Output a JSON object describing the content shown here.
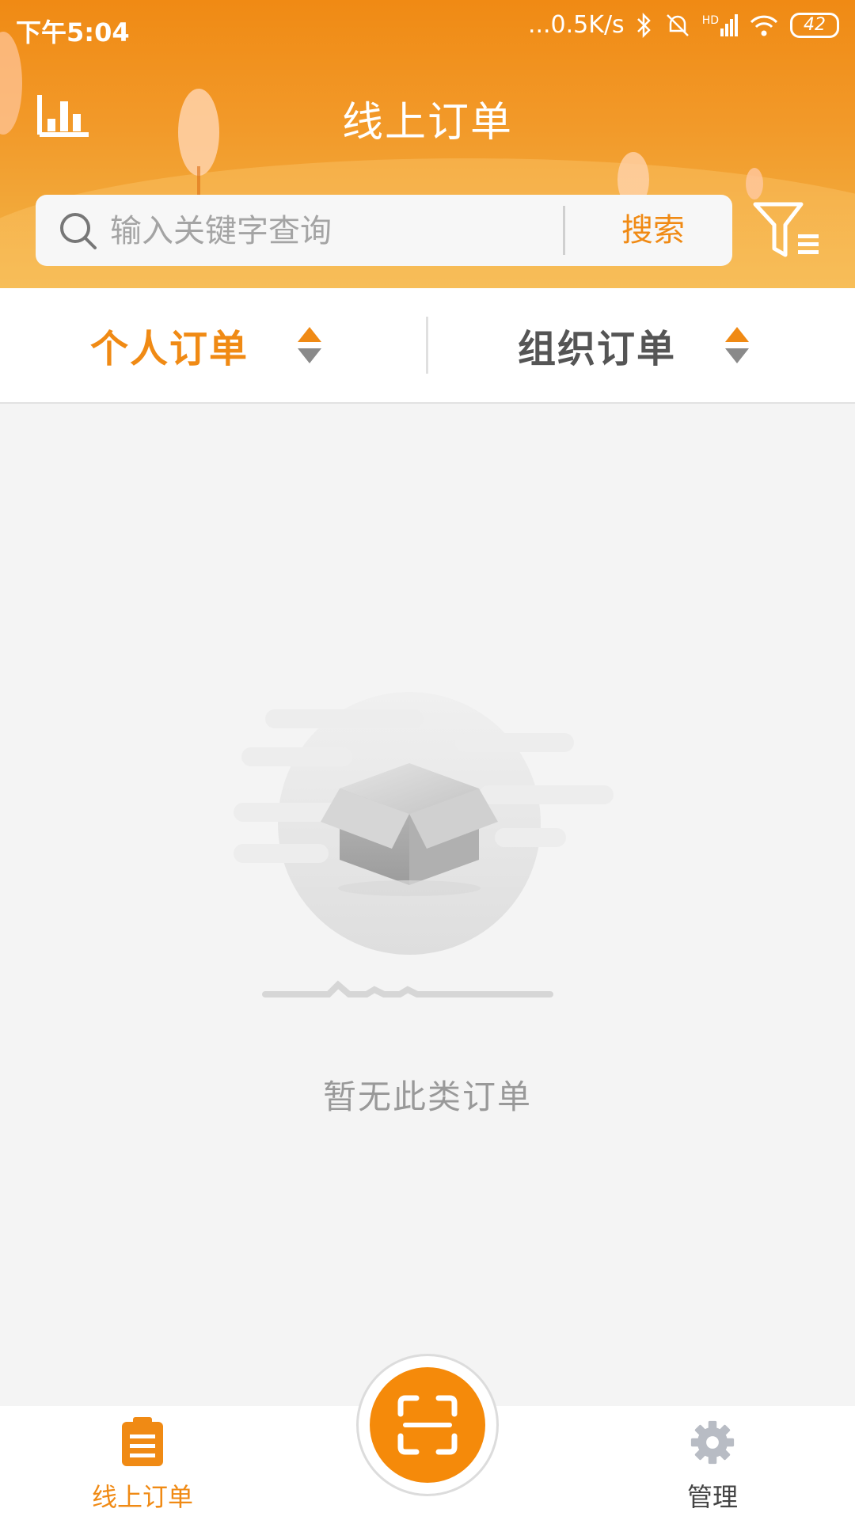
{
  "status_bar": {
    "time": "下午5:04",
    "net_speed": "...0.5K/s",
    "network": "HD",
    "battery": "42"
  },
  "header": {
    "title": "线上订单",
    "chart_icon": "bar-chart-icon",
    "filter_icon": "filter-list-icon"
  },
  "search": {
    "placeholder": "输入关键字查询",
    "value": "",
    "button_label": "搜索",
    "icon": "search-icon"
  },
  "tabs": [
    {
      "label": "个人订单",
      "active": true,
      "sort_icon": "sort-icon"
    },
    {
      "label": "组织订单",
      "active": false,
      "sort_icon": "sort-icon"
    }
  ],
  "empty_state": {
    "message": "暂无此类订单",
    "illustration": "empty-box-icon"
  },
  "bottom_nav": {
    "items": [
      {
        "label": "线上订单",
        "icon": "clipboard-icon",
        "active": true
      },
      {
        "label": "管理",
        "icon": "gear-icon",
        "active": false
      }
    ],
    "center_button_icon": "scan-icon"
  },
  "colors": {
    "accent": "#f08a14",
    "header_gradient_top": "#f08a14",
    "header_gradient_bottom": "#f3b548",
    "background": "#f4f4f4",
    "inactive_text": "#555555"
  }
}
